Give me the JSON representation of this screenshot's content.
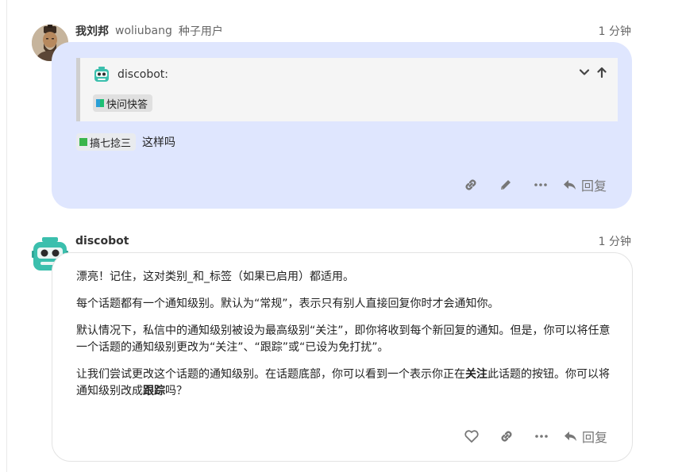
{
  "post1": {
    "username": "我刘邦",
    "handle": "woliubang",
    "user_title": "种子用户",
    "time": "1 分钟",
    "quote": {
      "username": "discobot:",
      "tag": "快问快答",
      "tag_colors": [
        "#2a9fd6",
        "#1dbf73"
      ]
    },
    "tag": "搞七捻三",
    "tag_color": "#3ab54a",
    "text_after": "这样吗",
    "reply_label": "回复"
  },
  "post2": {
    "username": "discobot",
    "time": "1 分钟",
    "paragraphs": [
      "漂亮！记住，这对类别_和_标签（如果已启用）都适用。",
      "每个话题都有一个通知级别。默认为“常规”，表示只有别人直接回复你时才会通知你。",
      "默认情况下，私信中的通知级别被设为最高级别“关注”，即你将收到每个新回复的通知。但是，你可以将任意一个话题的通知级别更改为“关注”、“跟踪”或“已设为免打扰”。"
    ],
    "para4": {
      "part1": "让我们尝试更改这个话题的通知级别。在话题底部，你可以看到一个表示你正在",
      "bold1": "关注",
      "part2": "此话题的按钮。你可以将通知级别改成",
      "bold2": "跟踪",
      "part3": "吗？"
    },
    "reply_label": "回复"
  },
  "colors": {
    "highlight_bg": "#dfe6fe",
    "bot_teal": "#3bbfad"
  }
}
